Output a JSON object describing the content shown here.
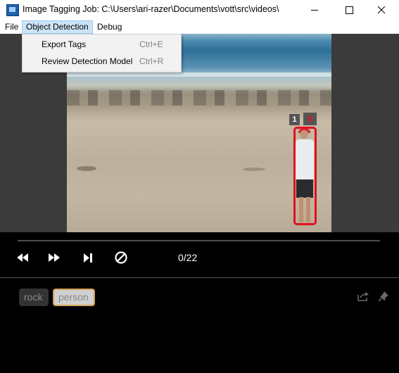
{
  "window": {
    "title": "Image Tagging Job: C:\\Users\\ari-razer\\Documents\\vott\\src\\videos\\",
    "min_glyph": "—",
    "max_glyph": "☐",
    "close_glyph": "✕"
  },
  "menubar": {
    "file": "File",
    "object_detection": "Object Detection",
    "debug": "Debug"
  },
  "dropdown": {
    "items": [
      {
        "label": "Export Tags",
        "shortcut": "Ctrl+E"
      },
      {
        "label": "Review Detection Model",
        "shortcut": "Ctrl+R"
      }
    ]
  },
  "region": {
    "tag_number": "1",
    "delete_glyph": "X",
    "color": "#e2101d"
  },
  "player": {
    "counter": "0/22",
    "progress": 0
  },
  "tags": [
    {
      "label": "rock",
      "selected": false
    },
    {
      "label": "person",
      "selected": true
    }
  ],
  "icons": {
    "rewind": "rewind-icon",
    "fast_forward": "fast-forward-icon",
    "skip_next": "skip-next-icon",
    "block": "block-icon",
    "export": "export-icon",
    "pin": "pin-icon"
  },
  "colors": {
    "accent_selected_tag": "#d4a055",
    "region_border": "#e2101d",
    "menu_highlight": "#cce4f7"
  }
}
